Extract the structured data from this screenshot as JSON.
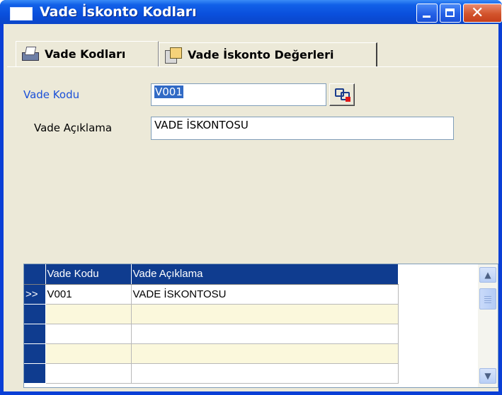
{
  "window": {
    "title": "Vade İskonto Kodları"
  },
  "tabs": [
    {
      "label": "Vade Kodları",
      "icon": "printer-icon",
      "active": true
    },
    {
      "label": "Vade İskonto Değerleri",
      "icon": "notes-icon",
      "active": false
    }
  ],
  "form": {
    "code_label": "Vade Kodu",
    "code_value": "V001",
    "desc_label": "Vade Açıklama",
    "desc_value": "VADE İSKONTOSU"
  },
  "grid": {
    "columns": [
      "Vade Kodu",
      "Vade Açıklama"
    ],
    "rows": [
      {
        "indicator": ">>",
        "code": "V001",
        "desc": "VADE İSKONTOSU"
      },
      {
        "indicator": "",
        "code": "",
        "desc": ""
      },
      {
        "indicator": "",
        "code": "",
        "desc": ""
      },
      {
        "indicator": "",
        "code": "",
        "desc": ""
      },
      {
        "indicator": "",
        "code": "",
        "desc": ""
      }
    ]
  },
  "colors": {
    "titlebar": "#0a4fdc",
    "grid_header": "#0f3c8f",
    "label_accent": "#1a50d8",
    "row_alt": "#fbf8dc"
  }
}
